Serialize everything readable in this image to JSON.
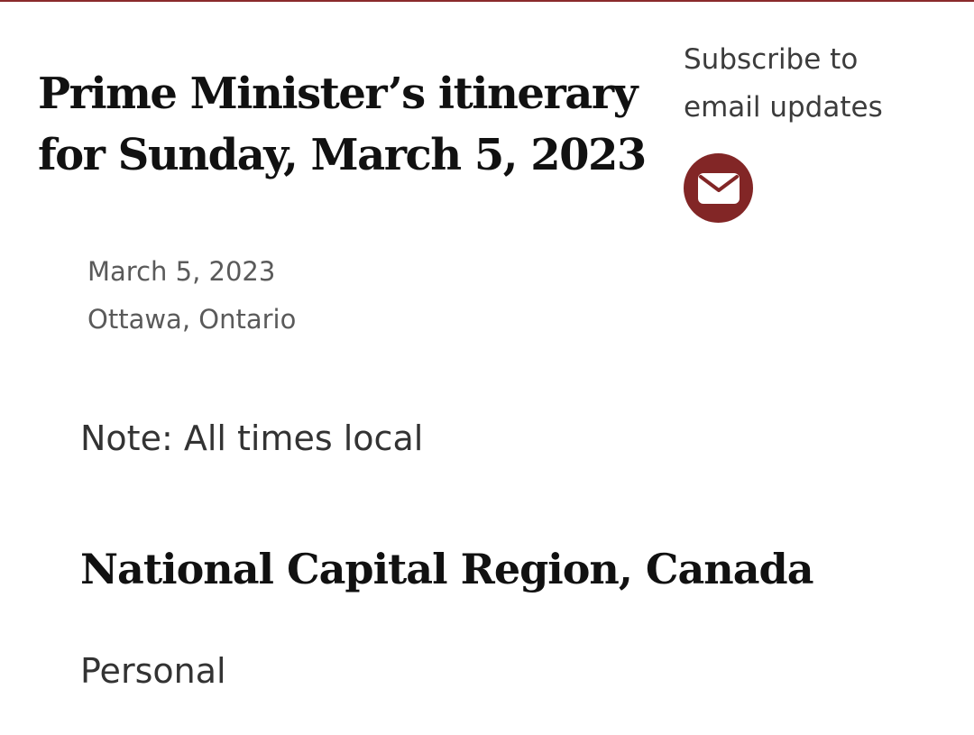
{
  "header": {
    "title_line1": "Prime Minister’s itinerary",
    "title_line2": "for Sunday, March 5, 2023"
  },
  "subscribe": {
    "line1": "Subscribe to",
    "line2": "email updates",
    "icon": "envelope-icon",
    "button_color": "#822626"
  },
  "meta": {
    "date": "March 5, 2023",
    "location": "Ottawa, Ontario"
  },
  "note": "Note: All times local",
  "section": {
    "heading": "National Capital Region, Canada",
    "items": [
      "Personal"
    ]
  },
  "colors": {
    "accent": "#8a2a2b"
  }
}
